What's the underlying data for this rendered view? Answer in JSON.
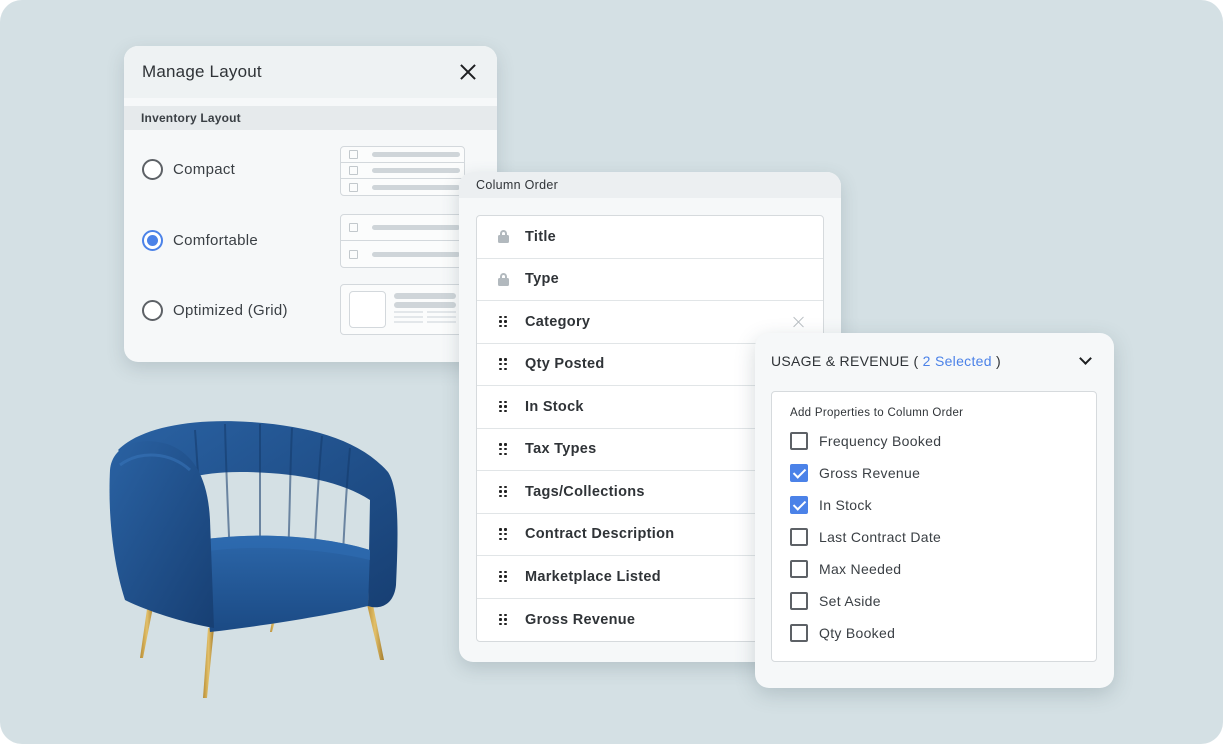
{
  "manage_layout": {
    "title": "Manage Layout",
    "close_icon": "close-icon",
    "section_label": "Inventory Layout",
    "options": [
      {
        "label": "Compact",
        "selected": false
      },
      {
        "label": "Comfortable",
        "selected": true
      },
      {
        "label": "Optimized (Grid)",
        "selected": false
      }
    ]
  },
  "column_order": {
    "title": "Column Order",
    "items": [
      {
        "label": "Title",
        "icon": "lock-icon",
        "removable": false
      },
      {
        "label": "Type",
        "icon": "lock-icon",
        "removable": false
      },
      {
        "label": "Category",
        "icon": "drag-handle-icon",
        "removable": true
      },
      {
        "label": "Qty Posted",
        "icon": "drag-handle-icon",
        "removable": false
      },
      {
        "label": "In Stock",
        "icon": "drag-handle-icon",
        "removable": false
      },
      {
        "label": "Tax Types",
        "icon": "drag-handle-icon",
        "removable": false
      },
      {
        "label": "Tags/Collections",
        "icon": "drag-handle-icon",
        "removable": false
      },
      {
        "label": "Contract Description",
        "icon": "drag-handle-icon",
        "removable": false
      },
      {
        "label": "Marketplace Listed",
        "icon": "drag-handle-icon",
        "removable": false
      },
      {
        "label": "Gross Revenue",
        "icon": "drag-handle-icon",
        "removable": false
      }
    ]
  },
  "usage_revenue": {
    "title": "USAGE & REVENUE",
    "open_paren": " ( ",
    "selected_text": "2 Selected",
    "close_paren": " )",
    "subtitle": "Add Properties to Column Order",
    "properties": [
      {
        "label": "Frequency Booked",
        "checked": false
      },
      {
        "label": "Gross Revenue",
        "checked": true
      },
      {
        "label": "In Stock",
        "checked": true
      },
      {
        "label": "Last Contract Date",
        "checked": false
      },
      {
        "label": "Max Needed",
        "checked": false
      },
      {
        "label": "Set Aside",
        "checked": false
      },
      {
        "label": "Qty Booked",
        "checked": false
      }
    ]
  },
  "colors": {
    "background": "#d4e0e4",
    "accent": "#4b82e8",
    "chair_velvet": "#1f4f8a",
    "chair_legs": "#c9a24a"
  }
}
